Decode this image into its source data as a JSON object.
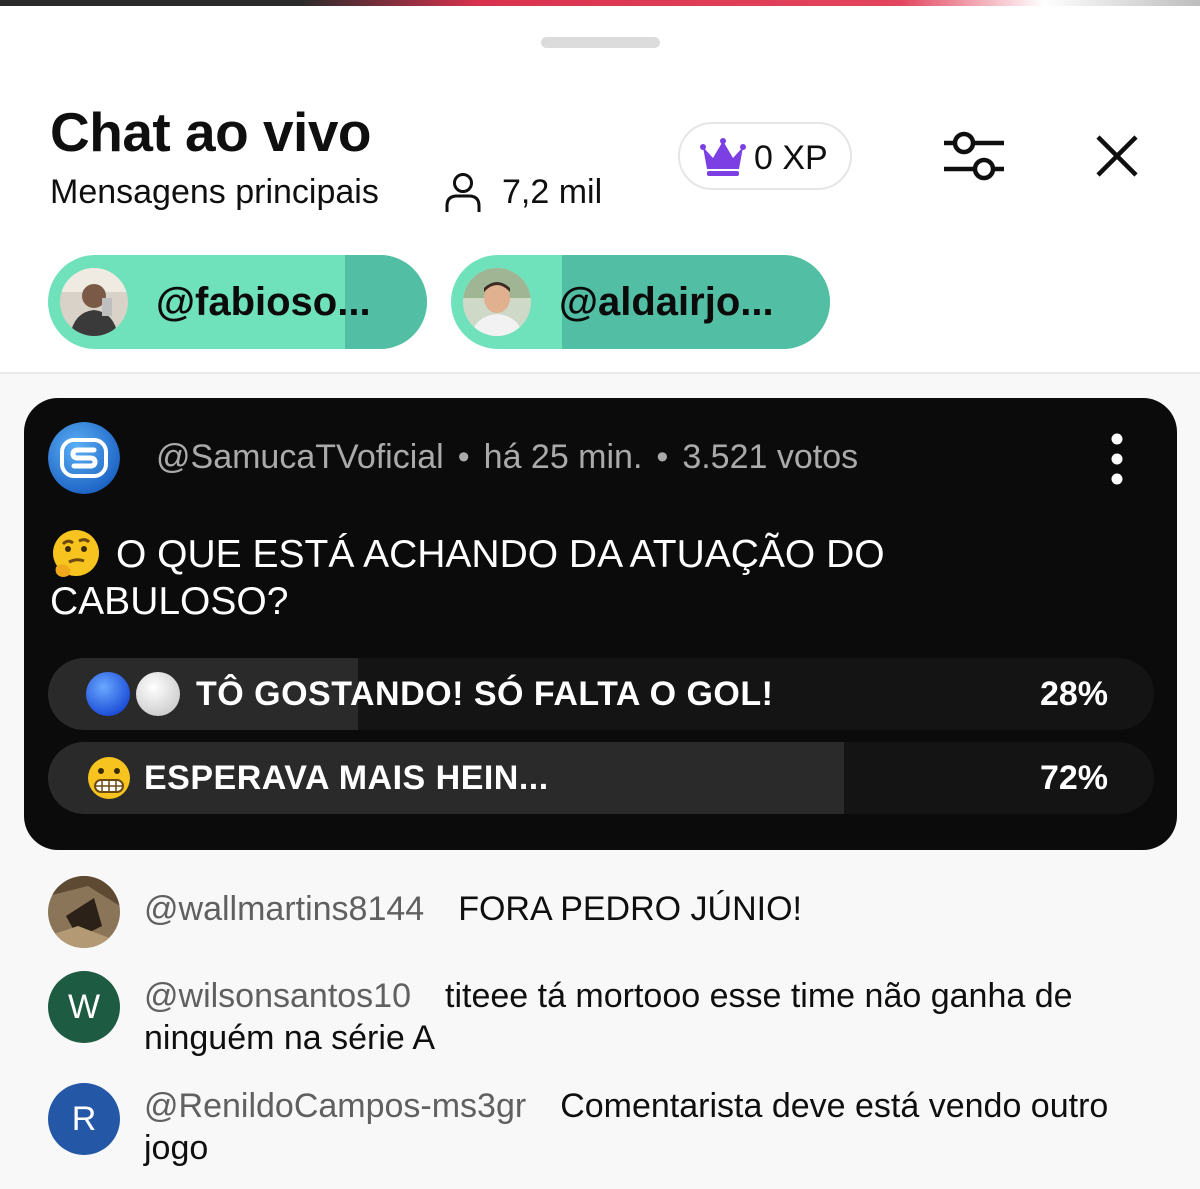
{
  "header": {
    "title": "Chat ao vivo",
    "subtitle": "Mensagens principais",
    "viewers": "7,2 mil",
    "xp": "0 XP"
  },
  "pinned_chips": [
    {
      "handle": "@fabioso..."
    },
    {
      "handle": "@aldairjo..."
    }
  ],
  "poll": {
    "author": "@SamucaTVoficial",
    "time": "há 25 min.",
    "votes": "3.521 votos",
    "question": "O QUE ESTÁ ACHANDO DA ATUAÇÃO DO CABULOSO?",
    "options": [
      {
        "label": "TÔ GOSTANDO! SÓ FALTA O GOL!",
        "percent_text": "28%",
        "percent": 28
      },
      {
        "label": "ESPERAVA MAIS HEIN...",
        "percent_text": "72%",
        "percent": 72
      }
    ]
  },
  "messages": [
    {
      "author": "@wallmartins8144",
      "text": "FORA PEDRO JÚNIO!",
      "avatar_letter": ""
    },
    {
      "author": "@wilsonsantos10",
      "text": "titeee tá mortooo esse time não ganha de ninguém na série A",
      "avatar_letter": "W",
      "avatar_color": "#1e5b43"
    },
    {
      "author": "@RenildoCampos-ms3gr",
      "text": "Comentarista deve está vendo outro jogo",
      "avatar_letter": "R",
      "avatar_color": "#2458a6"
    }
  ],
  "colors": {
    "chip_bg": "#6fe2bb",
    "poll_bg": "#0b0b0b",
    "crown": "#7b3fe4"
  }
}
